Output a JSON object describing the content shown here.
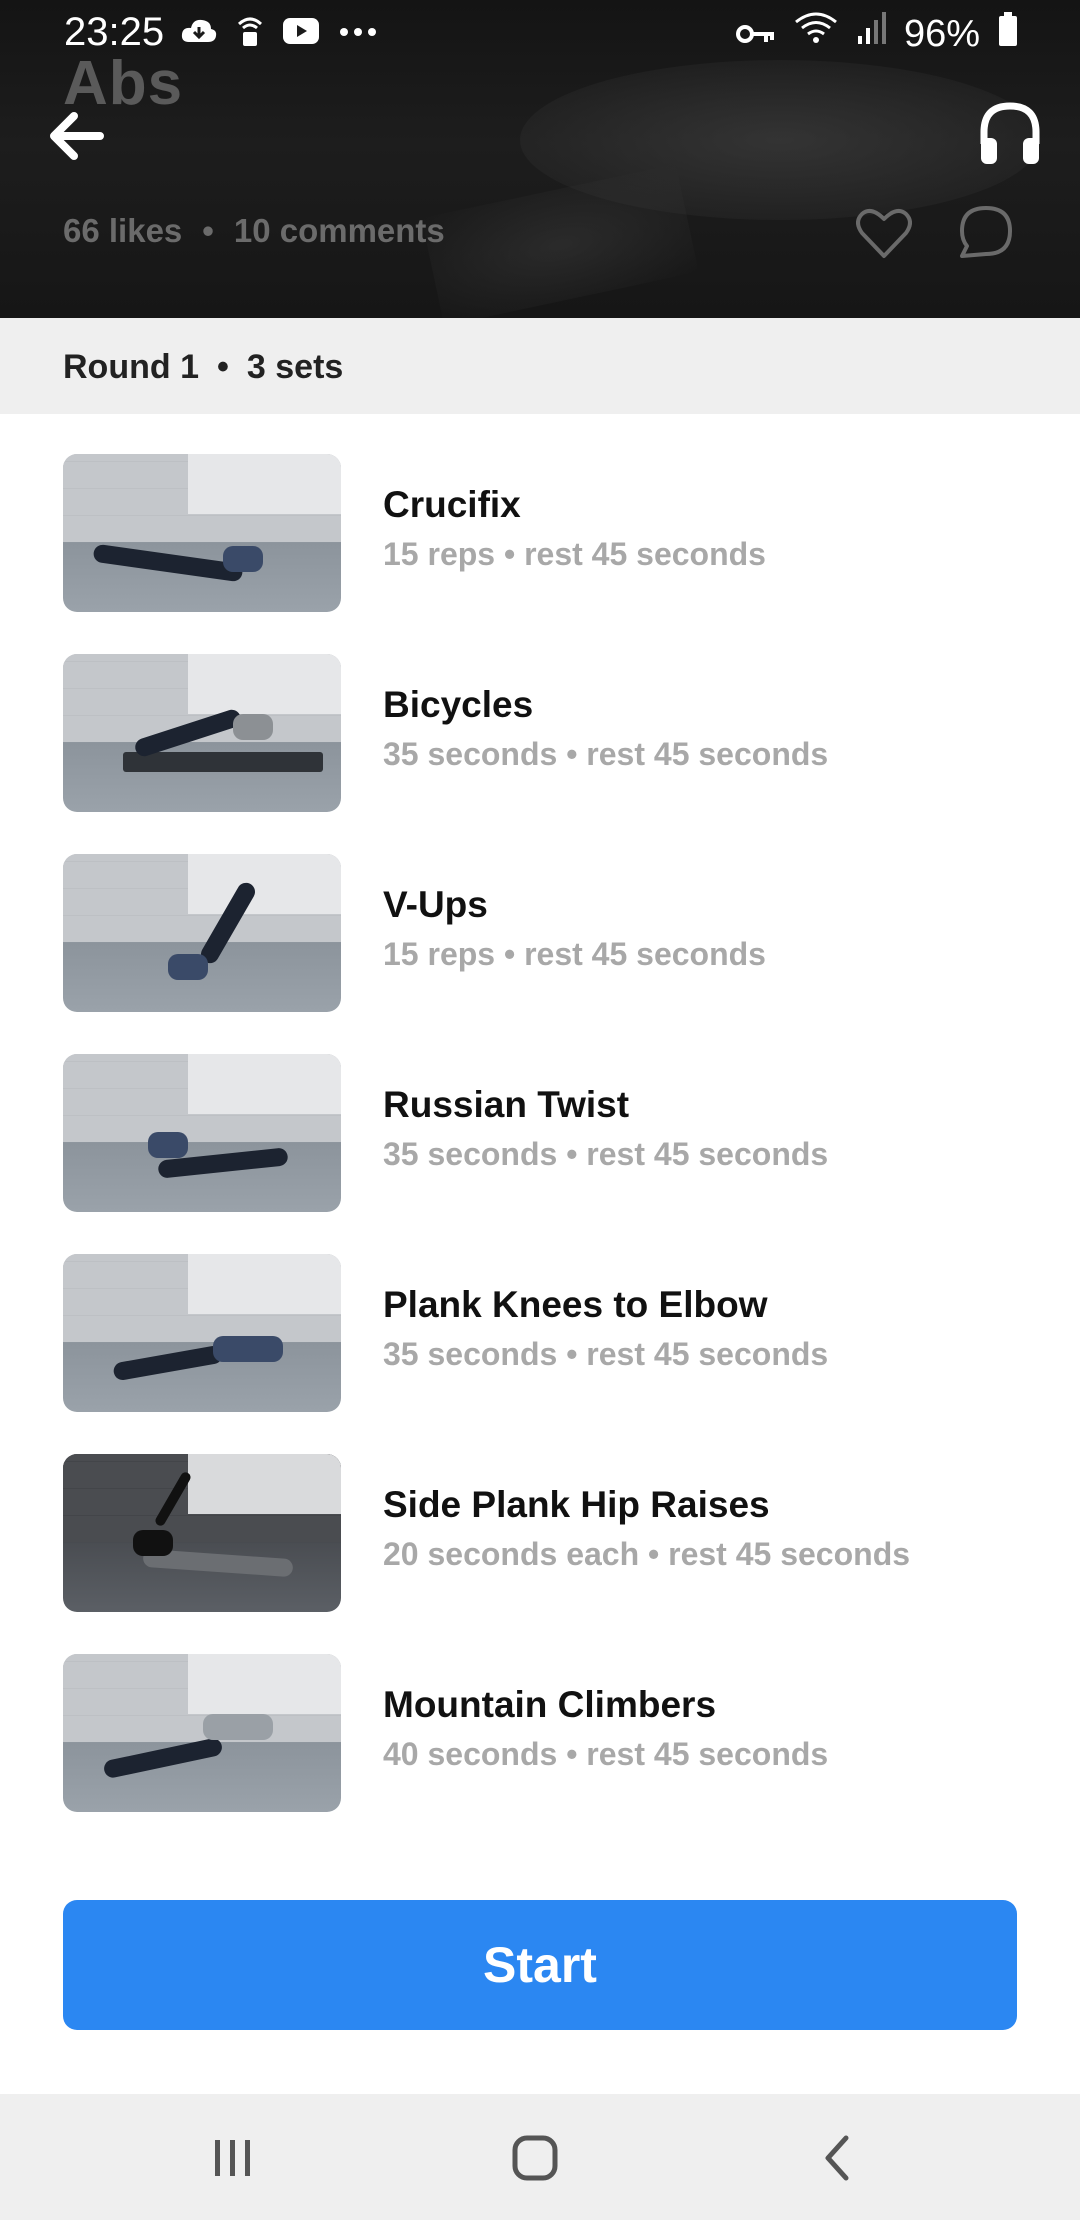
{
  "status_bar": {
    "time": "23:25",
    "battery": "96%",
    "icons": [
      "cloud-icon",
      "lock-wifi-icon",
      "youtube-icon",
      "more-icon",
      "key-icon",
      "wifi-icon",
      "signal-icon",
      "battery-icon"
    ]
  },
  "header": {
    "title": "Abs",
    "likes": "66 likes",
    "separator": "•",
    "comments": "10 comments"
  },
  "round": {
    "label": "Round 1",
    "separator": "•",
    "sets": "3 sets"
  },
  "exercises": [
    {
      "name": "Crucifix",
      "detail": "15 reps • rest 45 seconds"
    },
    {
      "name": "Bicycles",
      "detail": "35 seconds • rest 45 seconds"
    },
    {
      "name": "V-Ups",
      "detail": "15 reps • rest 45 seconds"
    },
    {
      "name": "Russian Twist",
      "detail": "35 seconds • rest 45 seconds"
    },
    {
      "name": "Plank Knees to Elbow",
      "detail": "35 seconds • rest 45 seconds"
    },
    {
      "name": "Side Plank Hip Raises",
      "detail": "20 seconds each • rest 45 seconds"
    },
    {
      "name": "Mountain Climbers",
      "detail": "40 seconds • rest 45 seconds"
    }
  ],
  "start_button": {
    "label": "Start"
  },
  "colors": {
    "accent": "#2b87f2",
    "hero_bg": "#1a1a1a",
    "muted_text": "#a8a8a8"
  }
}
